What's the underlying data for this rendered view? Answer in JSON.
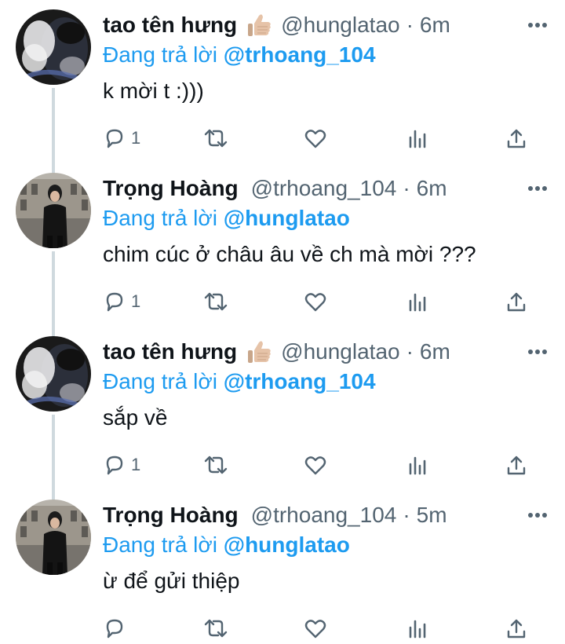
{
  "tweets": [
    {
      "display_name": "tao tên hưng",
      "emoji": "thumbs-up-light-skin",
      "handle": "@hunglatao",
      "separator": "·",
      "time": "6m",
      "reply_prefix": "Đang trả lời",
      "reply_to": "@trhoang_104",
      "text": "k mời t :)))",
      "reply_count": "1"
    },
    {
      "display_name": "Trọng Hoàng",
      "emoji": "",
      "handle": "@trhoang_104",
      "separator": "·",
      "time": "6m",
      "reply_prefix": "Đang trả lời",
      "reply_to": "@hunglatao",
      "text": "chim cúc ở châu âu về ch mà mời ???",
      "reply_count": "1"
    },
    {
      "display_name": "tao tên hưng",
      "emoji": "thumbs-up-light-skin",
      "handle": "@hunglatao",
      "separator": "·",
      "time": "6m",
      "reply_prefix": "Đang trả lời",
      "reply_to": "@trhoang_104",
      "text": "sắp về",
      "reply_count": "1"
    },
    {
      "display_name": "Trọng Hoàng",
      "emoji": "",
      "handle": "@trhoang_104",
      "separator": "·",
      "time": "5m",
      "reply_prefix": "Đang trả lời",
      "reply_to": "@hunglatao",
      "text": "ừ để gửi thiệp",
      "reply_count": ""
    }
  ],
  "icons": {
    "more": "more-horizontal-icon",
    "reply": "reply-icon",
    "retweet": "retweet-icon",
    "like": "heart-icon",
    "views": "analytics-icon",
    "share": "share-icon"
  },
  "colors": {
    "accent": "#1d9bf0",
    "secondary_text": "#536471",
    "primary_text": "#0f1419",
    "thread_line": "#cfd9de"
  }
}
